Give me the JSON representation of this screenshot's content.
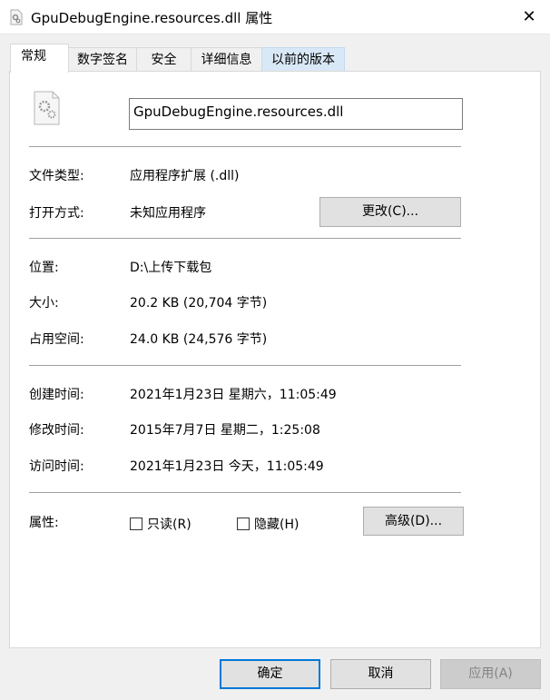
{
  "window": {
    "title": "GpuDebugEngine.resources.dll 属性",
    "close": "✕"
  },
  "tabs": [
    "常规",
    "数字签名",
    "安全",
    "详细信息",
    "以前的版本"
  ],
  "general": {
    "file_name": "GpuDebugEngine.resources.dll",
    "type_label": "文件类型:",
    "type_value": "应用程序扩展 (.dll)",
    "open_label": "打开方式:",
    "open_value": "未知应用程序",
    "change_button": "更改(C)...",
    "location_label": "位置:",
    "location_value": "D:\\上传下载包",
    "size_label": "大小:",
    "size_value": "20.2 KB (20,704 字节)",
    "disk_label": "占用空间:",
    "disk_value": "24.0 KB (24,576 字节)",
    "created_label": "创建时间:",
    "created_value": "2021年1月23日 星期六，11:05:49",
    "modified_label": "修改时间:",
    "modified_value": "2015年7月7日 星期二，1:25:08",
    "accessed_label": "访问时间:",
    "accessed_value": "2021年1月23日 今天，11:05:49",
    "attr_label": "属性:",
    "readonly": "只读(R)",
    "hidden": "隐藏(H)",
    "advanced_button": "高级(D)..."
  },
  "buttons": {
    "ok": "确定",
    "cancel": "取消",
    "apply": "应用(A)"
  }
}
